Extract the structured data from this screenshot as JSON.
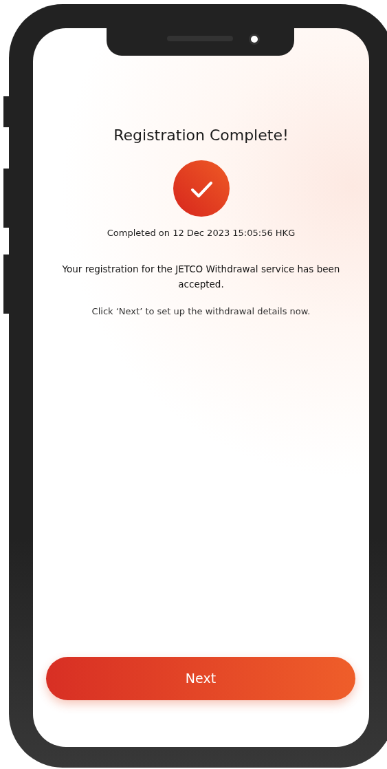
{
  "screen": {
    "title": "Registration Complete!",
    "completed_on": "Completed on 12 Dec 2023 15:05:56 HKG",
    "message": "Your registration for the JETCO Withdrawal service has been accepted.",
    "instruction": "Click ‘Next’ to set up the withdrawal details now.",
    "next_button": {
      "label": "Next"
    }
  }
}
